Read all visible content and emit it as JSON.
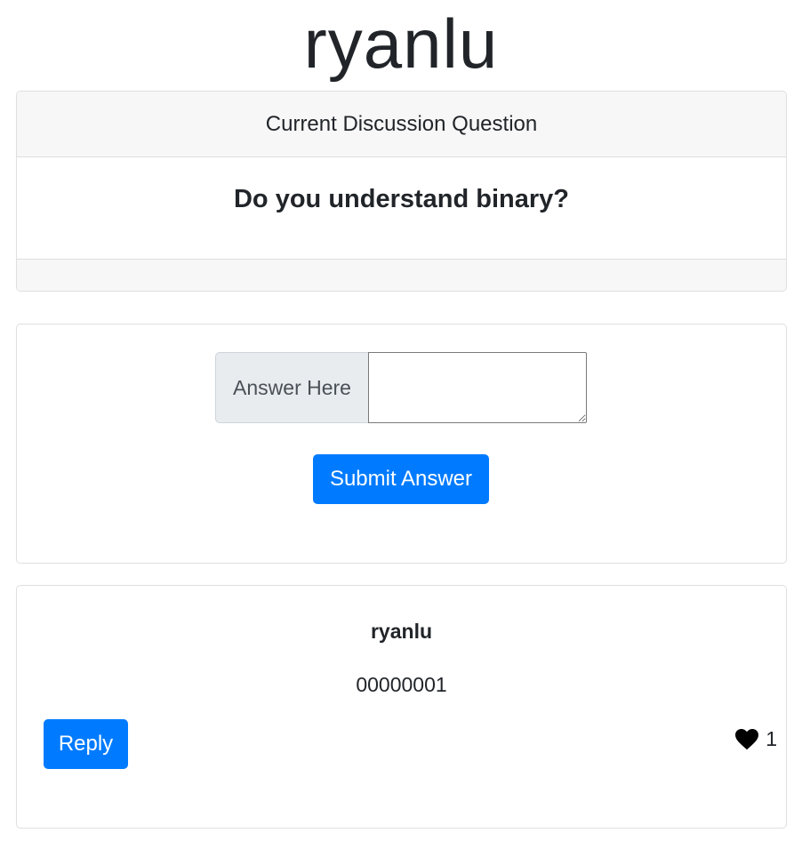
{
  "header": {
    "title": "ryanlu"
  },
  "question_card": {
    "header_label": "Current Discussion Question",
    "question": "Do you understand binary?"
  },
  "answer_form": {
    "addon_label": "Answer Here",
    "textarea_value": "",
    "submit_label": "Submit Answer"
  },
  "responses": [
    {
      "author": "ryanlu",
      "text": "00000001",
      "reply_label": "Reply",
      "like_icon": "heart-icon",
      "like_count": "1"
    }
  ],
  "colors": {
    "primary": "#007bff",
    "card_header_bg": "#f7f7f7",
    "input_addon_bg": "#e9ecef",
    "text": "#212529"
  }
}
